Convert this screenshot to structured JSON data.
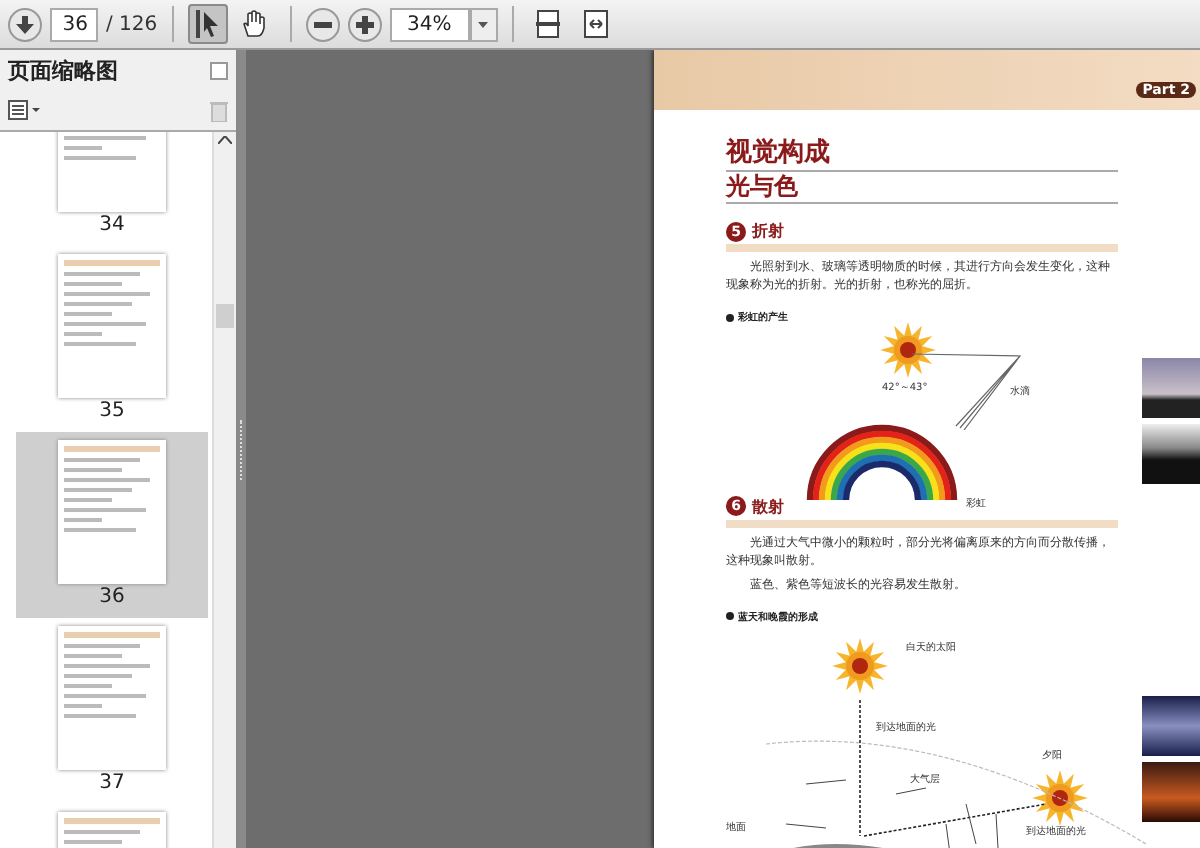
{
  "toolbar": {
    "page_number": "36",
    "page_total": "/ 126",
    "zoom": "34%",
    "tools": [
      {
        "kind": "select",
        "selected": true
      },
      {
        "kind": "hand",
        "selected": false
      }
    ]
  },
  "sidebar": {
    "title": "页面缩略图",
    "thumbnails": [
      {
        "label": "34",
        "selected": false
      },
      {
        "label": "35",
        "selected": false
      },
      {
        "label": "36",
        "selected": true
      },
      {
        "label": "37",
        "selected": false
      },
      {
        "selected": false
      }
    ]
  },
  "document": {
    "header_badge": "Part 2",
    "title": "视觉构成",
    "subtitle": "光与色",
    "sections": [
      {
        "number": "5",
        "heading": "折射",
        "paragraphs": [
          "光照射到水、玻璃等透明物质的时候，其进行方向会发生变化，这种现象称为光的折射。光的折射，也称光的屈折。"
        ],
        "figure_caption": "彩虹的产生",
        "kind": "rainbow",
        "figure_labels": [
          "42°～43°",
          "水滴",
          "彩虹"
        ]
      },
      {
        "number": "6",
        "heading": "散射",
        "paragraphs": [
          "光通过大气中微小的颗粒时，部分光将偏离原来的方向而分散传播，这种现象叫散射。",
          "蓝色、紫色等短波长的光容易发生散射。"
        ],
        "figure_caption": "蓝天和晚霞的形成",
        "kind": "sky",
        "figure_labels": [
          "白天的太阳",
          "到达地面的光",
          "大气层",
          "地面",
          "夕阳",
          "到达地面的光"
        ]
      }
    ]
  }
}
